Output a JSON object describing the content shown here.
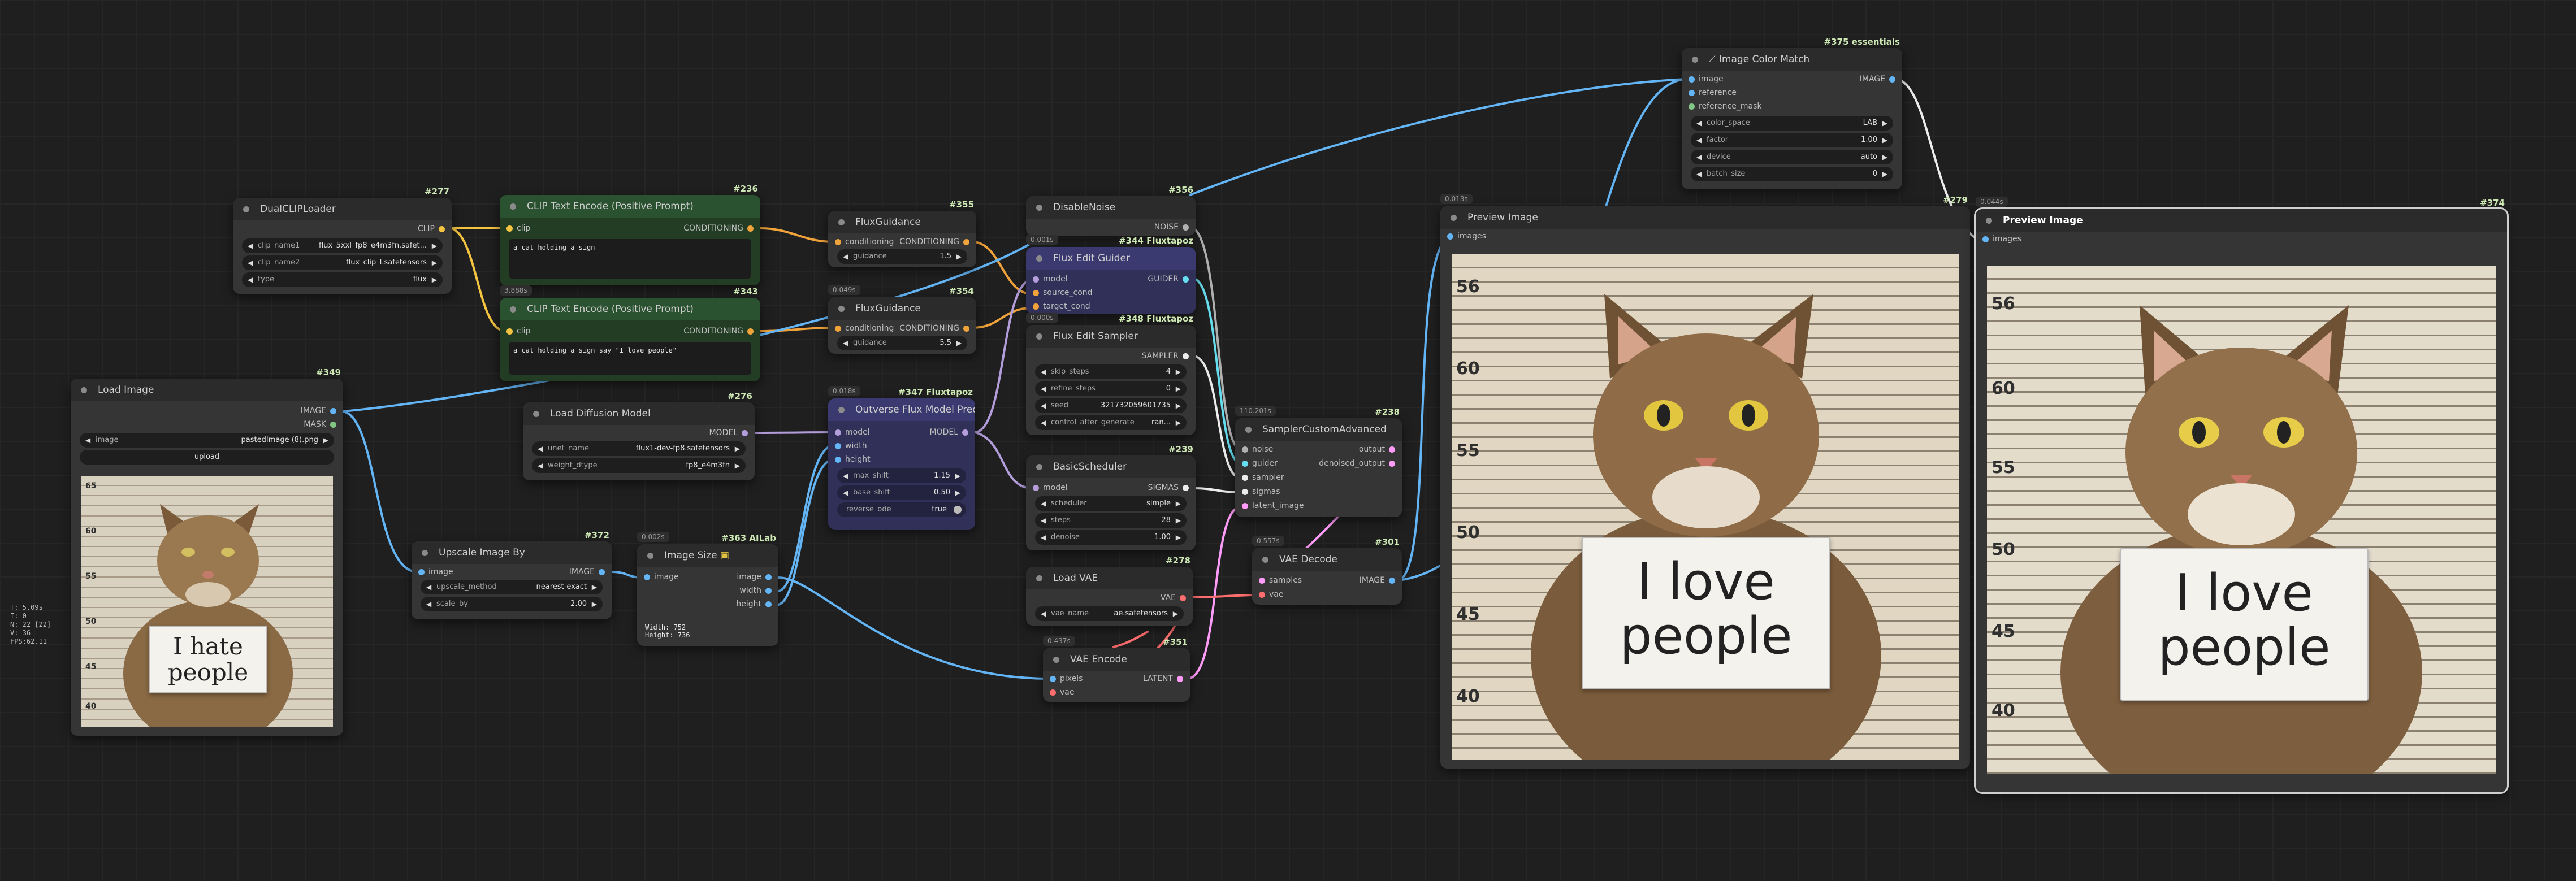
{
  "stats": [
    "T: 5.09s",
    "I: 0",
    "N: 22 [22]",
    "V: 36",
    "FPS:62.11"
  ],
  "nodes": {
    "dualclip": {
      "id": "#277",
      "title": "DualCLIPLoader",
      "out": "CLIP",
      "w": [
        {
          "l": "clip_name1",
          "v": "flux_5xxl_fp8_e4m3fn.safet..."
        },
        {
          "l": "clip_name2",
          "v": "flux_clip_l.safetensors"
        },
        {
          "l": "type",
          "v": "flux"
        }
      ]
    },
    "cte1": {
      "id": "#236",
      "title": "CLIP Text Encode (Positive Prompt)",
      "in": "clip",
      "out": "CONDITIONING",
      "text": "a cat holding a sign"
    },
    "cte2": {
      "id": "#343",
      "time": "3.888s",
      "title": "CLIP Text Encode (Positive Prompt)",
      "in": "clip",
      "out": "CONDITIONING",
      "text": "a cat holding a sign say \"I love people\""
    },
    "fg1": {
      "id": "#355",
      "title": "FluxGuidance",
      "in": "conditioning",
      "out": "CONDITIONING",
      "w": [
        {
          "l": "guidance",
          "v": "1.5"
        }
      ]
    },
    "fg2": {
      "id": "#354",
      "time": "0.049s",
      "title": "FluxGuidance",
      "in": "conditioning",
      "out": "CONDITIONING",
      "w": [
        {
          "l": "guidance",
          "v": "5.5"
        }
      ]
    },
    "loadimg": {
      "id": "#349",
      "title": "Load Image",
      "outs": [
        "IMAGE",
        "MASK"
      ],
      "image": "pastedImage (8).png",
      "upload": "upload",
      "sign1": "I hate",
      "sign2": "people",
      "heights": [
        "65",
        "60",
        "55",
        "50",
        "45",
        "40"
      ]
    },
    "loaddiff": {
      "id": "#276",
      "title": "Load Diffusion Model",
      "out": "MODEL",
      "w": [
        {
          "l": "unet_name",
          "v": "flux1-dev-fp8.safetensors"
        },
        {
          "l": "weight_dtype",
          "v": "fp8_e4m3fn"
        }
      ]
    },
    "outverse": {
      "id": "#347 Fluxtapoz",
      "time": "0.018s",
      "title": "Outverse Flux Model Pred",
      "ins": [
        "model",
        "width",
        "height"
      ],
      "out": "MODEL",
      "w": [
        {
          "l": "max_shift",
          "v": "1.15"
        },
        {
          "l": "base_shift",
          "v": "0.50"
        }
      ],
      "toggle": {
        "l": "reverse_ode",
        "v": "true"
      }
    },
    "upscale": {
      "id": "#372",
      "title": "Upscale Image By",
      "in": "image",
      "out": "IMAGE",
      "w": [
        {
          "l": "upscale_method",
          "v": "nearest-exact"
        },
        {
          "l": "scale_by",
          "v": "2.00"
        }
      ]
    },
    "imgsize": {
      "id": "#363 AILab",
      "time": "0.002s",
      "title": "Image Size",
      "in": "image",
      "outs": [
        "image",
        "width",
        "height"
      ],
      "info": "Width: 752\nHeight: 736"
    },
    "disnoise": {
      "id": "#356",
      "title": "DisableNoise",
      "out": "NOISE"
    },
    "fguider": {
      "id": "#344 Fluxtapoz",
      "time": "0.001s",
      "title": "Flux Edit Guider",
      "ins": [
        "model",
        "source_cond",
        "target_cond"
      ],
      "out": "GUIDER"
    },
    "fsampler": {
      "id": "#348 Fluxtapoz",
      "time": "0.000s",
      "title": "Flux Edit Sampler",
      "out": "SAMPLER",
      "w": [
        {
          "l": "skip_steps",
          "v": "4"
        },
        {
          "l": "refine_steps",
          "v": "0"
        },
        {
          "l": "seed",
          "v": "321732059601735"
        },
        {
          "l": "control_after_generate",
          "v": "ran..."
        }
      ]
    },
    "bsched": {
      "id": "#239",
      "title": "BasicScheduler",
      "in": "model",
      "out": "SIGMAS",
      "w": [
        {
          "l": "scheduler",
          "v": "simple"
        },
        {
          "l": "steps",
          "v": "28"
        },
        {
          "l": "denoise",
          "v": "1.00"
        }
      ]
    },
    "loadvae": {
      "id": "#278",
      "title": "Load VAE",
      "out": "VAE",
      "w": [
        {
          "l": "vae_name",
          "v": "ae.safetensors"
        }
      ]
    },
    "vaeenc": {
      "id": "#351",
      "time": "0.437s",
      "title": "VAE Encode",
      "ins": [
        "pixels",
        "vae"
      ],
      "out": "LATENT"
    },
    "sca": {
      "id": "#238",
      "time": "110.201s",
      "title": "SamplerCustomAdvanced",
      "ins": [
        "noise",
        "guider",
        "sampler",
        "sigmas",
        "latent_image"
      ],
      "outs": [
        "output",
        "denoised_output"
      ]
    },
    "vaedec": {
      "id": "#301",
      "time": "0.557s",
      "title": "VAE Decode",
      "ins": [
        "samples",
        "vae"
      ],
      "out": "IMAGE"
    },
    "colormatch": {
      "id": "#375 essentials",
      "title": "Image Color Match",
      "ins": [
        "image",
        "reference",
        "reference_mask"
      ],
      "out": "IMAGE",
      "w": [
        {
          "l": "color_space",
          "v": "LAB"
        },
        {
          "l": "factor",
          "v": "1.00"
        },
        {
          "l": "device",
          "v": "auto"
        },
        {
          "l": "batch_size",
          "v": "0"
        }
      ]
    },
    "prev1": {
      "id": "#279",
      "time": "0.013s",
      "title": "Preview Image",
      "in": "images",
      "sign1": "I love",
      "sign2": "people",
      "heights": [
        "56",
        "60",
        "55",
        "50",
        "45",
        "40"
      ]
    },
    "prev2": {
      "id": "#374",
      "time": "0.044s",
      "title": "Preview Image",
      "in": "images",
      "sign1": "I love",
      "sign2": "people",
      "heights": [
        "56",
        "60",
        "55",
        "50",
        "45",
        "40"
      ]
    }
  },
  "colors": {
    "clip": "#f5c542",
    "conditioning": "#f0a33a",
    "model": "#b39ddb",
    "image": "#64b5f6",
    "latent": "#ff9cf9",
    "vae": "#ff6e6e",
    "noise": "#b0b0b0",
    "sampler": "#ececec",
    "guider": "#66ddee",
    "int": "#9fd3a0",
    "mask": "#81c784"
  }
}
